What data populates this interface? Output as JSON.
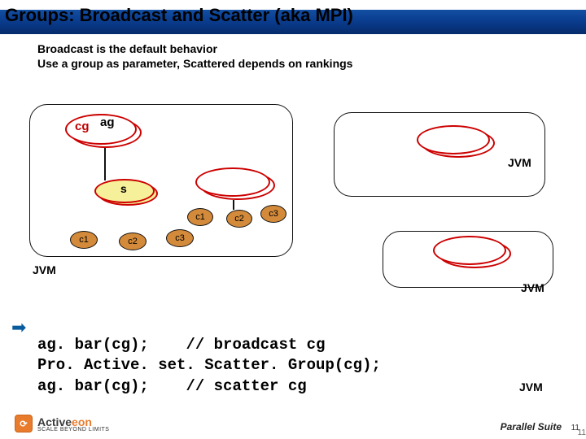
{
  "title": "Groups: Broadcast  and  Scatter (aka MPI)",
  "explain_line1": "Broadcast is the default behavior",
  "explain_line2": "Use a group as parameter, Scattered depends on rankings",
  "labels": {
    "cg": "cg",
    "ag": "ag",
    "s": "s",
    "c1": "c1",
    "c2": "c2",
    "c3": "c3",
    "jvm": "JVM"
  },
  "code": {
    "l1a": "ag. bar(cg);    ",
    "l1b": "// broadcast cg",
    "l2": "Pro. Active. set. Scatter. Group(cg);",
    "l3a": "ag. bar(cg);    ",
    "l3b": "// scatter cg"
  },
  "footer": {
    "brand_active": "Active",
    "brand_eon": "eon",
    "tagline": "SCALE BEYOND LIMITS",
    "right": "Parallel Suite",
    "logo_glyph": "⟳"
  },
  "page": "11"
}
